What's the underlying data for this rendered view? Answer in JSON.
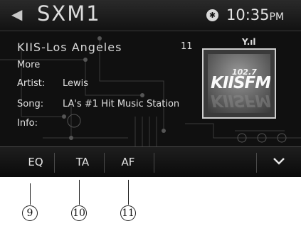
{
  "header": {
    "back_icon": "◀",
    "source": "SXM1",
    "bluetooth_icon": "✱",
    "time": "10:35",
    "ampm": "PM"
  },
  "station": {
    "name": "KIIS-Los Angeles",
    "channel": "11",
    "more_label": "More",
    "signal_icon": "Y.ıl",
    "fields": [
      {
        "label": "Artist:",
        "value": "Lewis"
      },
      {
        "label": "Song:",
        "value": "LA's #1 Hit Music Station"
      },
      {
        "label": "Info:",
        "value": ""
      }
    ]
  },
  "logo": {
    "freq": "102.7",
    "name": "KIISFM"
  },
  "softkeys": {
    "eq": "EQ",
    "ta": "TA",
    "af": "AF",
    "chevron_icon": "chevron-down"
  },
  "callouts": [
    "9",
    "10",
    "11"
  ]
}
